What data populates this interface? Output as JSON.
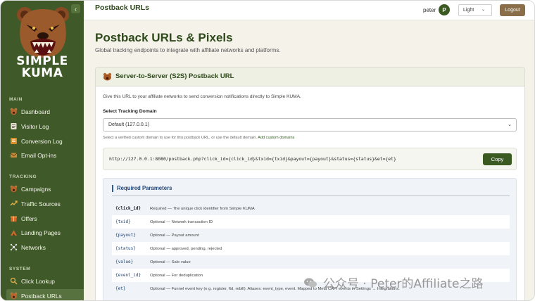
{
  "sidebar": {
    "brand_line1": "SIMPLE",
    "brand_line2": "KUMA",
    "collapse_glyph": "‹",
    "sections": {
      "main": "MAIN",
      "tracking": "TRACKING",
      "system": "SYSTEM"
    },
    "items": [
      {
        "label": "Dashboard",
        "icon": "bear-icon"
      },
      {
        "label": "Visitor Log",
        "icon": "log-icon"
      },
      {
        "label": "Conversion Log",
        "icon": "conversion-icon"
      },
      {
        "label": "Email Opt-ins",
        "icon": "email-icon"
      },
      {
        "label": "Campaigns",
        "icon": "bear-icon"
      },
      {
        "label": "Traffic Sources",
        "icon": "traffic-icon"
      },
      {
        "label": "Offers",
        "icon": "offers-icon"
      },
      {
        "label": "Landing Pages",
        "icon": "landing-icon"
      },
      {
        "label": "Networks",
        "icon": "network-icon"
      },
      {
        "label": "Click Lookup",
        "icon": "lookup-icon"
      },
      {
        "label": "Postback URLs",
        "icon": "bear-icon",
        "active": true
      }
    ]
  },
  "topbar": {
    "title": "Postback URLs",
    "user": "peter",
    "avatar_initial": "P",
    "theme": "Light",
    "theme_caret": "⌄",
    "logout": "Logout"
  },
  "main": {
    "title": "Postback URLs & Pixels",
    "subtitle": "Global tracking endpoints to integrate with affiliate networks and platforms."
  },
  "s2s": {
    "title": "Server-to-Server (S2S) Postback URL",
    "description": "Give this URL to your affiliate networks to send conversion notifications directly to Simple KUMA.",
    "domain_label": "Select Tracking Domain",
    "domain_value": "Default (127.0.0.1)",
    "domain_caret": "⌄",
    "help_text": "Select a verified custom domain to use for this postback URL, or use the default domain.",
    "help_link": "Add custom domains",
    "url": "http://127.0.0.1:8080/postback.php?click_id={click_id}&txid={txid}&payout={payout}&status={status}&et={et}",
    "copy_label": "Copy"
  },
  "params": {
    "title": "Required Parameters",
    "rows": [
      {
        "key": "{click_id}",
        "desc": "Required — The unique click identifier from Simple KUMA"
      },
      {
        "key": "{txid}",
        "desc": "Optional — Network transaction ID"
      },
      {
        "key": "{payout}",
        "desc": "Optional — Payout amount"
      },
      {
        "key": "{status}",
        "desc": "Optional — approved, pending, rejected"
      },
      {
        "key": "{value}",
        "desc": "Optional — Sale value"
      },
      {
        "key": "{event_id}",
        "desc": "Optional — For deduplication"
      },
      {
        "key": "{et}",
        "desc": "Optional — Funnel event key (e.g. register, ftd, rebill). Aliases: event_type, event. Mapped to Meta CAPI events in Settings → Integrations."
      }
    ]
  },
  "watermark": "公众号 · Peter的Affiliate之路",
  "colors": {
    "sidebar": "#3f5a28",
    "accent": "#3a5a22",
    "logout": "#8a6e4a",
    "param_key": "#1f4373"
  }
}
